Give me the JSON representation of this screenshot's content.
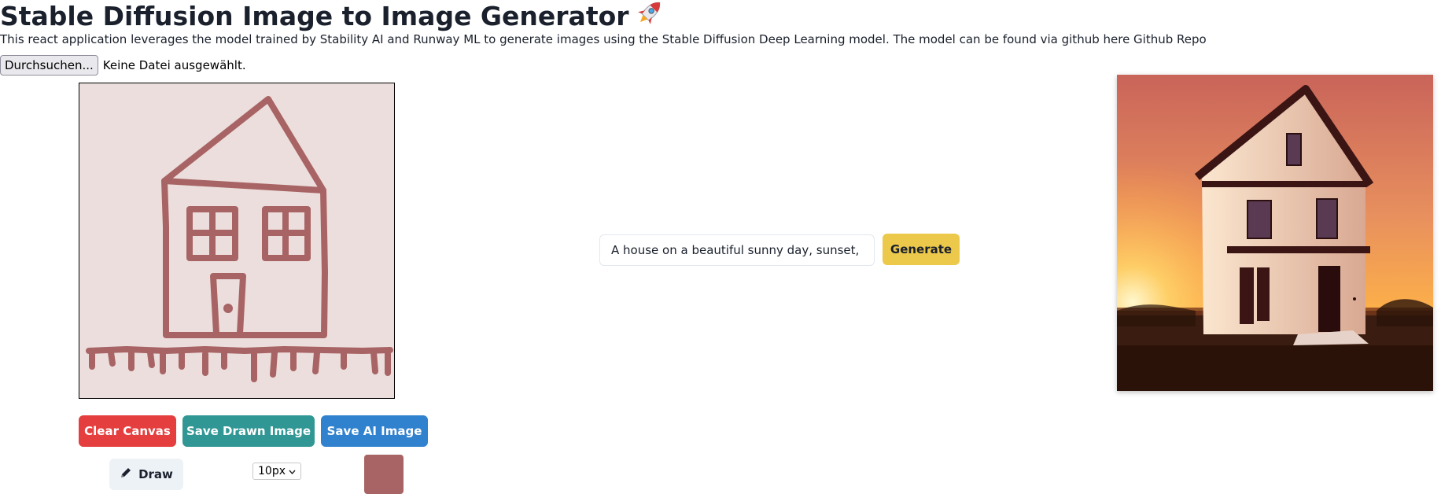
{
  "header": {
    "title": "Stable Diffusion Image to Image Generator",
    "title_emoji_icon": "rocket-icon",
    "description": "This react application leverages the model trained by Stability AI and Runway ML to generate images using the Stable Diffusion Deep Learning model. The model can be found via github here Github Repo"
  },
  "file_input": {
    "button_label": "Durchsuchen...",
    "status": "Keine Datei ausgewählt."
  },
  "canvas": {
    "background_color": "#ecdedd",
    "stroke_color": "#a86464"
  },
  "actions": {
    "clear_label": "Clear Canvas",
    "save_drawn_label": "Save Drawn Image",
    "save_ai_label": "Save AI Image",
    "clear_color": "#e53e3e",
    "save_drawn_color": "#319795",
    "save_ai_color": "#3182ce"
  },
  "tools": {
    "draw_label": "Draw",
    "draw_icon": "pencil-icon",
    "brush_size": "10px",
    "brush_color": "#a86464"
  },
  "prompt": {
    "value": "A house on a beautiful sunny day, sunset, cin",
    "generate_label": "Generate",
    "generate_color": "#ecc94b"
  }
}
